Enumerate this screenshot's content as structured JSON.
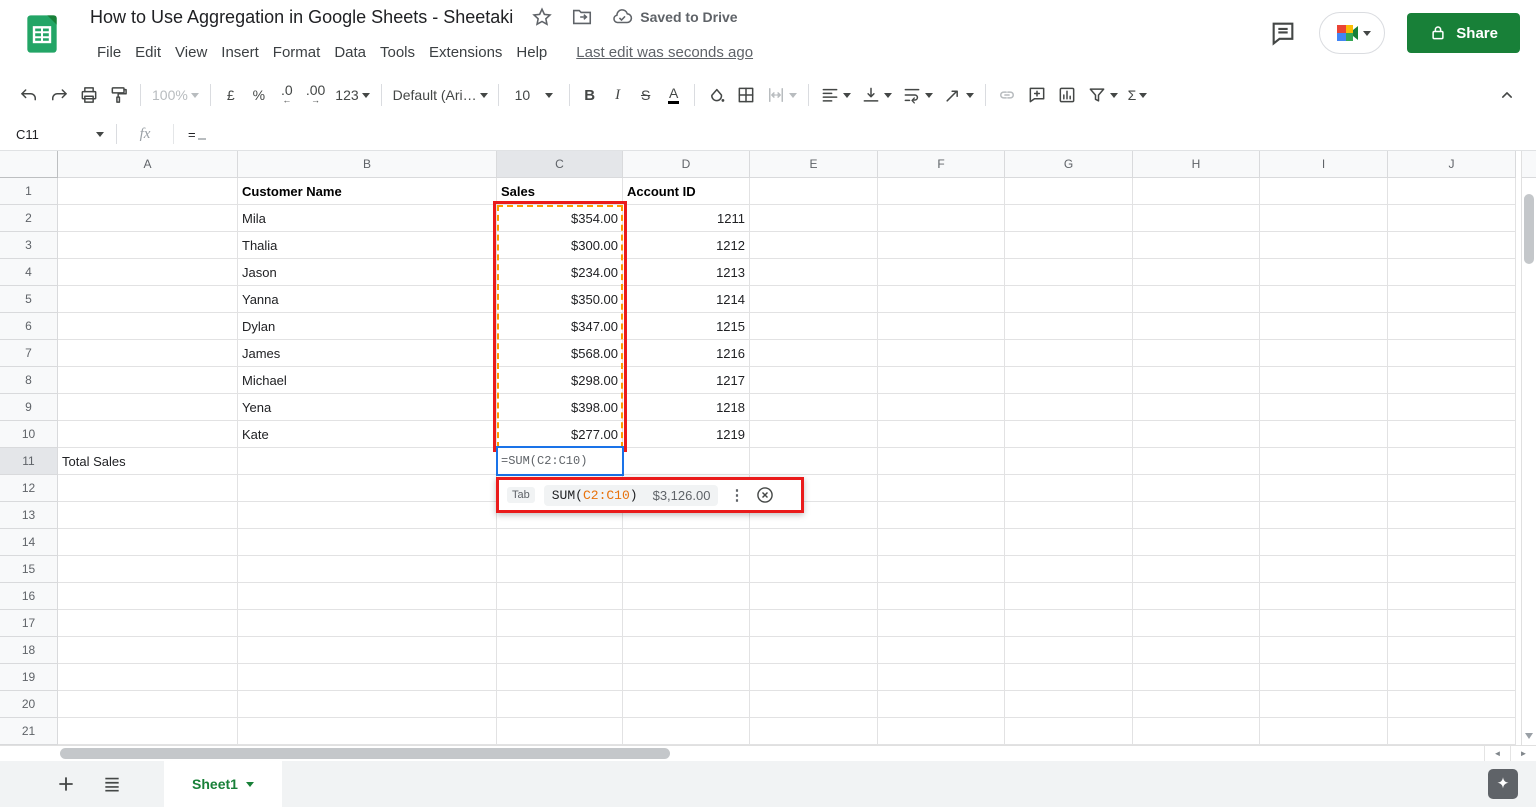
{
  "titlebar": {
    "title": "How to Use Aggregation in Google Sheets - Sheetaki",
    "saved_status": "Saved to Drive",
    "last_edit": "Last edit was seconds ago",
    "share_label": "Share",
    "menu_items": [
      {
        "id": "file",
        "label": "File"
      },
      {
        "id": "edit",
        "label": "Edit"
      },
      {
        "id": "view",
        "label": "View"
      },
      {
        "id": "insert",
        "label": "Insert"
      },
      {
        "id": "format",
        "label": "Format"
      },
      {
        "id": "data",
        "label": "Data"
      },
      {
        "id": "tools",
        "label": "Tools"
      },
      {
        "id": "extensions",
        "label": "Extensions"
      },
      {
        "id": "help",
        "label": "Help"
      }
    ]
  },
  "toolbar": {
    "items": [
      {
        "type": "icon",
        "name": "undo-icon"
      },
      {
        "type": "icon",
        "name": "redo-icon"
      },
      {
        "type": "icon",
        "name": "print-icon"
      },
      {
        "type": "icon",
        "name": "paint-format-icon"
      },
      {
        "type": "divider"
      },
      {
        "type": "text",
        "name": "zoom-select",
        "label": "100%",
        "caret": true,
        "disabled": true
      },
      {
        "type": "divider"
      },
      {
        "type": "text",
        "name": "format-currency-button",
        "label": "£"
      },
      {
        "type": "text",
        "name": "format-percent-button",
        "label": "%"
      },
      {
        "type": "decimal",
        "name": "decrease-decimal-button",
        "label": ".0",
        "arrow": "←"
      },
      {
        "type": "decimal",
        "name": "increase-decimal-button",
        "label": ".00",
        "arrow": "→"
      },
      {
        "type": "text",
        "name": "number-format-button",
        "label": "123",
        "caret": true
      },
      {
        "type": "divider"
      },
      {
        "type": "text",
        "name": "font-select",
        "label": "Default (Ari…",
        "caret": true,
        "style": "wide"
      },
      {
        "type": "divider"
      },
      {
        "type": "text",
        "name": "font-size-select",
        "label": "10",
        "caret": true,
        "style": "size"
      },
      {
        "type": "divider"
      },
      {
        "type": "text",
        "name": "bold-button",
        "label": "B",
        "style": "bold"
      },
      {
        "type": "text",
        "name": "italic-button",
        "label": "I",
        "style": "italic"
      },
      {
        "type": "text",
        "name": "strikethrough-button",
        "label": "S",
        "style": "strike"
      },
      {
        "type": "text",
        "name": "text-color-button",
        "label": "A",
        "style": "textcolor"
      },
      {
        "type": "divider"
      },
      {
        "type": "icon",
        "name": "fill-color-icon"
      },
      {
        "type": "icon",
        "name": "borders-icon"
      },
      {
        "type": "icon",
        "name": "merge-cells-icon",
        "caret": true,
        "disabled": true
      },
      {
        "type": "divider"
      },
      {
        "type": "icon",
        "name": "horizontal-align-icon",
        "caret": true
      },
      {
        "type": "icon",
        "name": "vertical-align-icon",
        "caret": true
      },
      {
        "type": "icon",
        "name": "text-wrap-icon",
        "caret": true
      },
      {
        "type": "icon",
        "name": "text-rotation-icon",
        "caret": true
      },
      {
        "type": "divider"
      },
      {
        "type": "icon",
        "name": "insert-link-icon",
        "disabled": true
      },
      {
        "type": "icon",
        "name": "insert-comment-icon"
      },
      {
        "type": "icon",
        "name": "insert-chart-icon"
      },
      {
        "type": "icon",
        "name": "filter-icon",
        "caret": true
      },
      {
        "type": "text",
        "name": "functions-button",
        "label": "Σ",
        "caret": true
      }
    ]
  },
  "formula_bar": {
    "name_box": "C11",
    "fx_label": "fx",
    "content": "="
  },
  "grid": {
    "column_headers": [
      "A",
      "B",
      "C",
      "D",
      "E",
      "F",
      "G",
      "H",
      "I",
      "J"
    ],
    "row_count": 21,
    "selected_column": "C",
    "selected_row": 11,
    "header_cells": [
      {
        "col": "B",
        "text": "Customer Name"
      },
      {
        "col": "C",
        "text": "Sales"
      },
      {
        "col": "D",
        "text": "Account ID"
      }
    ],
    "records": [
      {
        "name": "Mila",
        "sales": "$354.00",
        "account_id": "1211"
      },
      {
        "name": "Thalia",
        "sales": "$300.00",
        "account_id": "1212"
      },
      {
        "name": "Jason",
        "sales": "$234.00",
        "account_id": "1213"
      },
      {
        "name": "Yanna",
        "sales": "$350.00",
        "account_id": "1214"
      },
      {
        "name": "Dylan",
        "sales": "$347.00",
        "account_id": "1215"
      },
      {
        "name": "James",
        "sales": "$568.00",
        "account_id": "1216"
      },
      {
        "name": "Michael",
        "sales": "$298.00",
        "account_id": "1217"
      },
      {
        "name": "Yena",
        "sales": "$398.00",
        "account_id": "1218"
      },
      {
        "name": "Kate",
        "sales": "$277.00",
        "account_id": "1219"
      }
    ],
    "total_label": "Total Sales",
    "active_cell_formula": "=SUM(C2:C10)"
  },
  "suggestion": {
    "tab_key": "Tab",
    "formula_prefix": "SUM(",
    "formula_range": "C2:C10",
    "formula_suffix": ")",
    "result": "$3,126.00"
  },
  "footer": {
    "sheet_name": "Sheet1"
  },
  "colors": {
    "share_green": "#188038",
    "sheets_green": "#23a566",
    "annotation_red": "#ea1b1b",
    "range_orange": "#e8710a",
    "active_cell_blue": "#1a73e8"
  }
}
